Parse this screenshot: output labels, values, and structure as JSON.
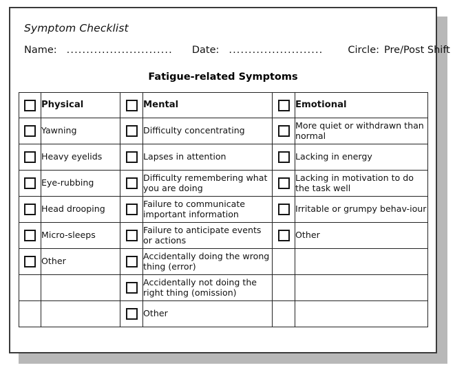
{
  "document": {
    "title": "Symptom Checklist",
    "meta": {
      "name_label": "Name:",
      "name_value_dots": "...........................",
      "date_label": "Date:",
      "date_value_dots": "........................",
      "circle_label": "Circle:",
      "circle_options": "Pre/Post Shift"
    },
    "section_title": "Fatigue-related Symptoms"
  },
  "table": {
    "headers": [
      {
        "checkbox": "unchecked",
        "label": "Physical"
      },
      {
        "checkbox": "unchecked",
        "label": "Mental"
      },
      {
        "checkbox": "unchecked",
        "label": "Emotional"
      }
    ],
    "rows": [
      {
        "physical": {
          "has_checkbox": true,
          "checkbox": "unchecked",
          "label": "Yawning"
        },
        "mental": {
          "has_checkbox": true,
          "checkbox": "unchecked",
          "label": "Difficulty concentrating"
        },
        "emotional": {
          "has_checkbox": true,
          "checkbox": "unchecked",
          "label": "More quiet or withdrawn than normal"
        }
      },
      {
        "physical": {
          "has_checkbox": true,
          "checkbox": "unchecked",
          "label": "Heavy eyelids"
        },
        "mental": {
          "has_checkbox": true,
          "checkbox": "unchecked",
          "label": "Lapses in attention"
        },
        "emotional": {
          "has_checkbox": true,
          "checkbox": "unchecked",
          "label": "Lacking in energy"
        }
      },
      {
        "physical": {
          "has_checkbox": true,
          "checkbox": "unchecked",
          "label": "Eye-rubbing"
        },
        "mental": {
          "has_checkbox": true,
          "checkbox": "unchecked",
          "label": "Difficulty remembering what you are doing"
        },
        "emotional": {
          "has_checkbox": true,
          "checkbox": "unchecked",
          "label": "Lacking in motivation to do the task well"
        }
      },
      {
        "physical": {
          "has_checkbox": true,
          "checkbox": "unchecked",
          "label": "Head drooping"
        },
        "mental": {
          "has_checkbox": true,
          "checkbox": "unchecked",
          "label": "Failure to communicate important information"
        },
        "emotional": {
          "has_checkbox": true,
          "checkbox": "unchecked",
          "label": "Irritable or grumpy behav-iour"
        }
      },
      {
        "physical": {
          "has_checkbox": true,
          "checkbox": "unchecked",
          "label": "Micro-sleeps"
        },
        "mental": {
          "has_checkbox": true,
          "checkbox": "unchecked",
          "label": "Failure to anticipate events or actions"
        },
        "emotional": {
          "has_checkbox": true,
          "checkbox": "unchecked",
          "label": "Other"
        }
      },
      {
        "physical": {
          "has_checkbox": true,
          "checkbox": "unchecked",
          "label": "Other"
        },
        "mental": {
          "has_checkbox": true,
          "checkbox": "unchecked",
          "label": "Accidentally doing the wrong thing (error)"
        },
        "emotional": {
          "has_checkbox": false,
          "label": ""
        }
      },
      {
        "physical": {
          "has_checkbox": false,
          "label": ""
        },
        "mental": {
          "has_checkbox": true,
          "checkbox": "unchecked",
          "label": "Accidentally not doing the right thing (omission)"
        },
        "emotional": {
          "has_checkbox": false,
          "label": ""
        }
      },
      {
        "physical": {
          "has_checkbox": false,
          "label": ""
        },
        "mental": {
          "has_checkbox": true,
          "checkbox": "unchecked",
          "label": "Other"
        },
        "emotional": {
          "has_checkbox": false,
          "label": ""
        }
      }
    ]
  },
  "colors": {
    "page_background": "#ffffff",
    "page_border": "#3a3a3a",
    "shadow": "#b8b8b8",
    "table_border": "#222222",
    "text": "#111111"
  }
}
